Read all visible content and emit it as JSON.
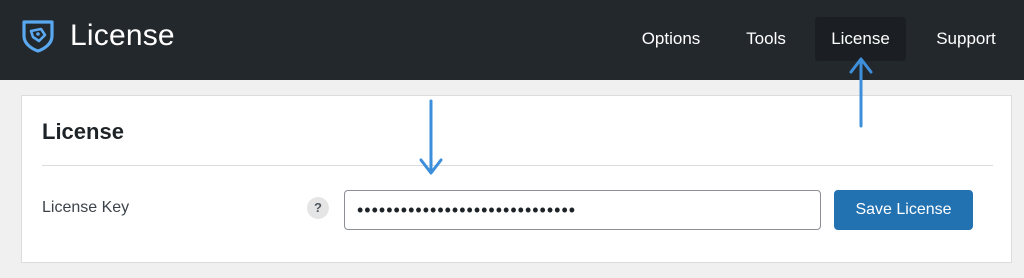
{
  "header": {
    "title": "License",
    "logo_icon": "shield-logo-icon",
    "nav": [
      {
        "label": "Options",
        "active": false
      },
      {
        "label": "Tools",
        "active": false
      },
      {
        "label": "License",
        "active": true
      },
      {
        "label": "Support",
        "active": false
      }
    ]
  },
  "card": {
    "title": "License",
    "field_label": "License Key",
    "help_symbol": "?",
    "license_key_value": "••••••••••••••••••••••••••••••",
    "save_label": "Save License"
  },
  "colors": {
    "header_bg": "#23282d",
    "active_tab_bg": "#1b1f23",
    "button_bg": "#2271b1",
    "annotation_arrow": "#3d8fdc",
    "logo": "#5aa9f0"
  }
}
